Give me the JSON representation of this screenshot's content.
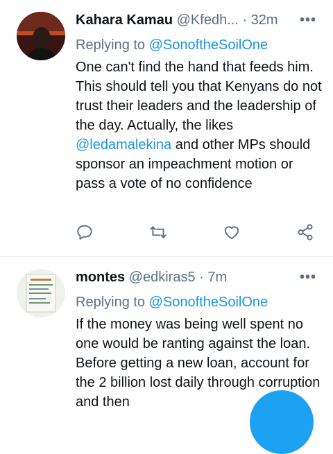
{
  "tweets": [
    {
      "name": "Kahara Kamau",
      "handle": "@Kfedh...",
      "separator": "·",
      "time": "32m",
      "more_label": "•••",
      "replying_label": "Replying to",
      "replying_to": "@SonoftheSoilOne",
      "body_parts": [
        "One can't find the hand that feeds him. This should tell you that Kenyans do not trust their leaders and the leadership of the day. Actually, the likes ",
        "@ledamalekina",
        " and other MPs should sponsor an impeachment motion or pass a vote of no confidence"
      ]
    },
    {
      "name": "montes",
      "handle": "@edkiras5",
      "separator": "·",
      "time": "7m",
      "more_label": "•••",
      "replying_label": "Replying to",
      "replying_to": "@SonoftheSoilOne",
      "body": "If the money was being well spent no one would be ranting against the loan. Before getting a new loan, account for the 2 billion lost daily through corruption and then"
    }
  ],
  "icons": [
    "reply-icon",
    "retweet-icon",
    "like-icon",
    "share-icon"
  ],
  "colors": {
    "accent": "#1b95e0",
    "muted": "#5b7083",
    "text": "#0f1419",
    "fab": "#1da1f2"
  }
}
